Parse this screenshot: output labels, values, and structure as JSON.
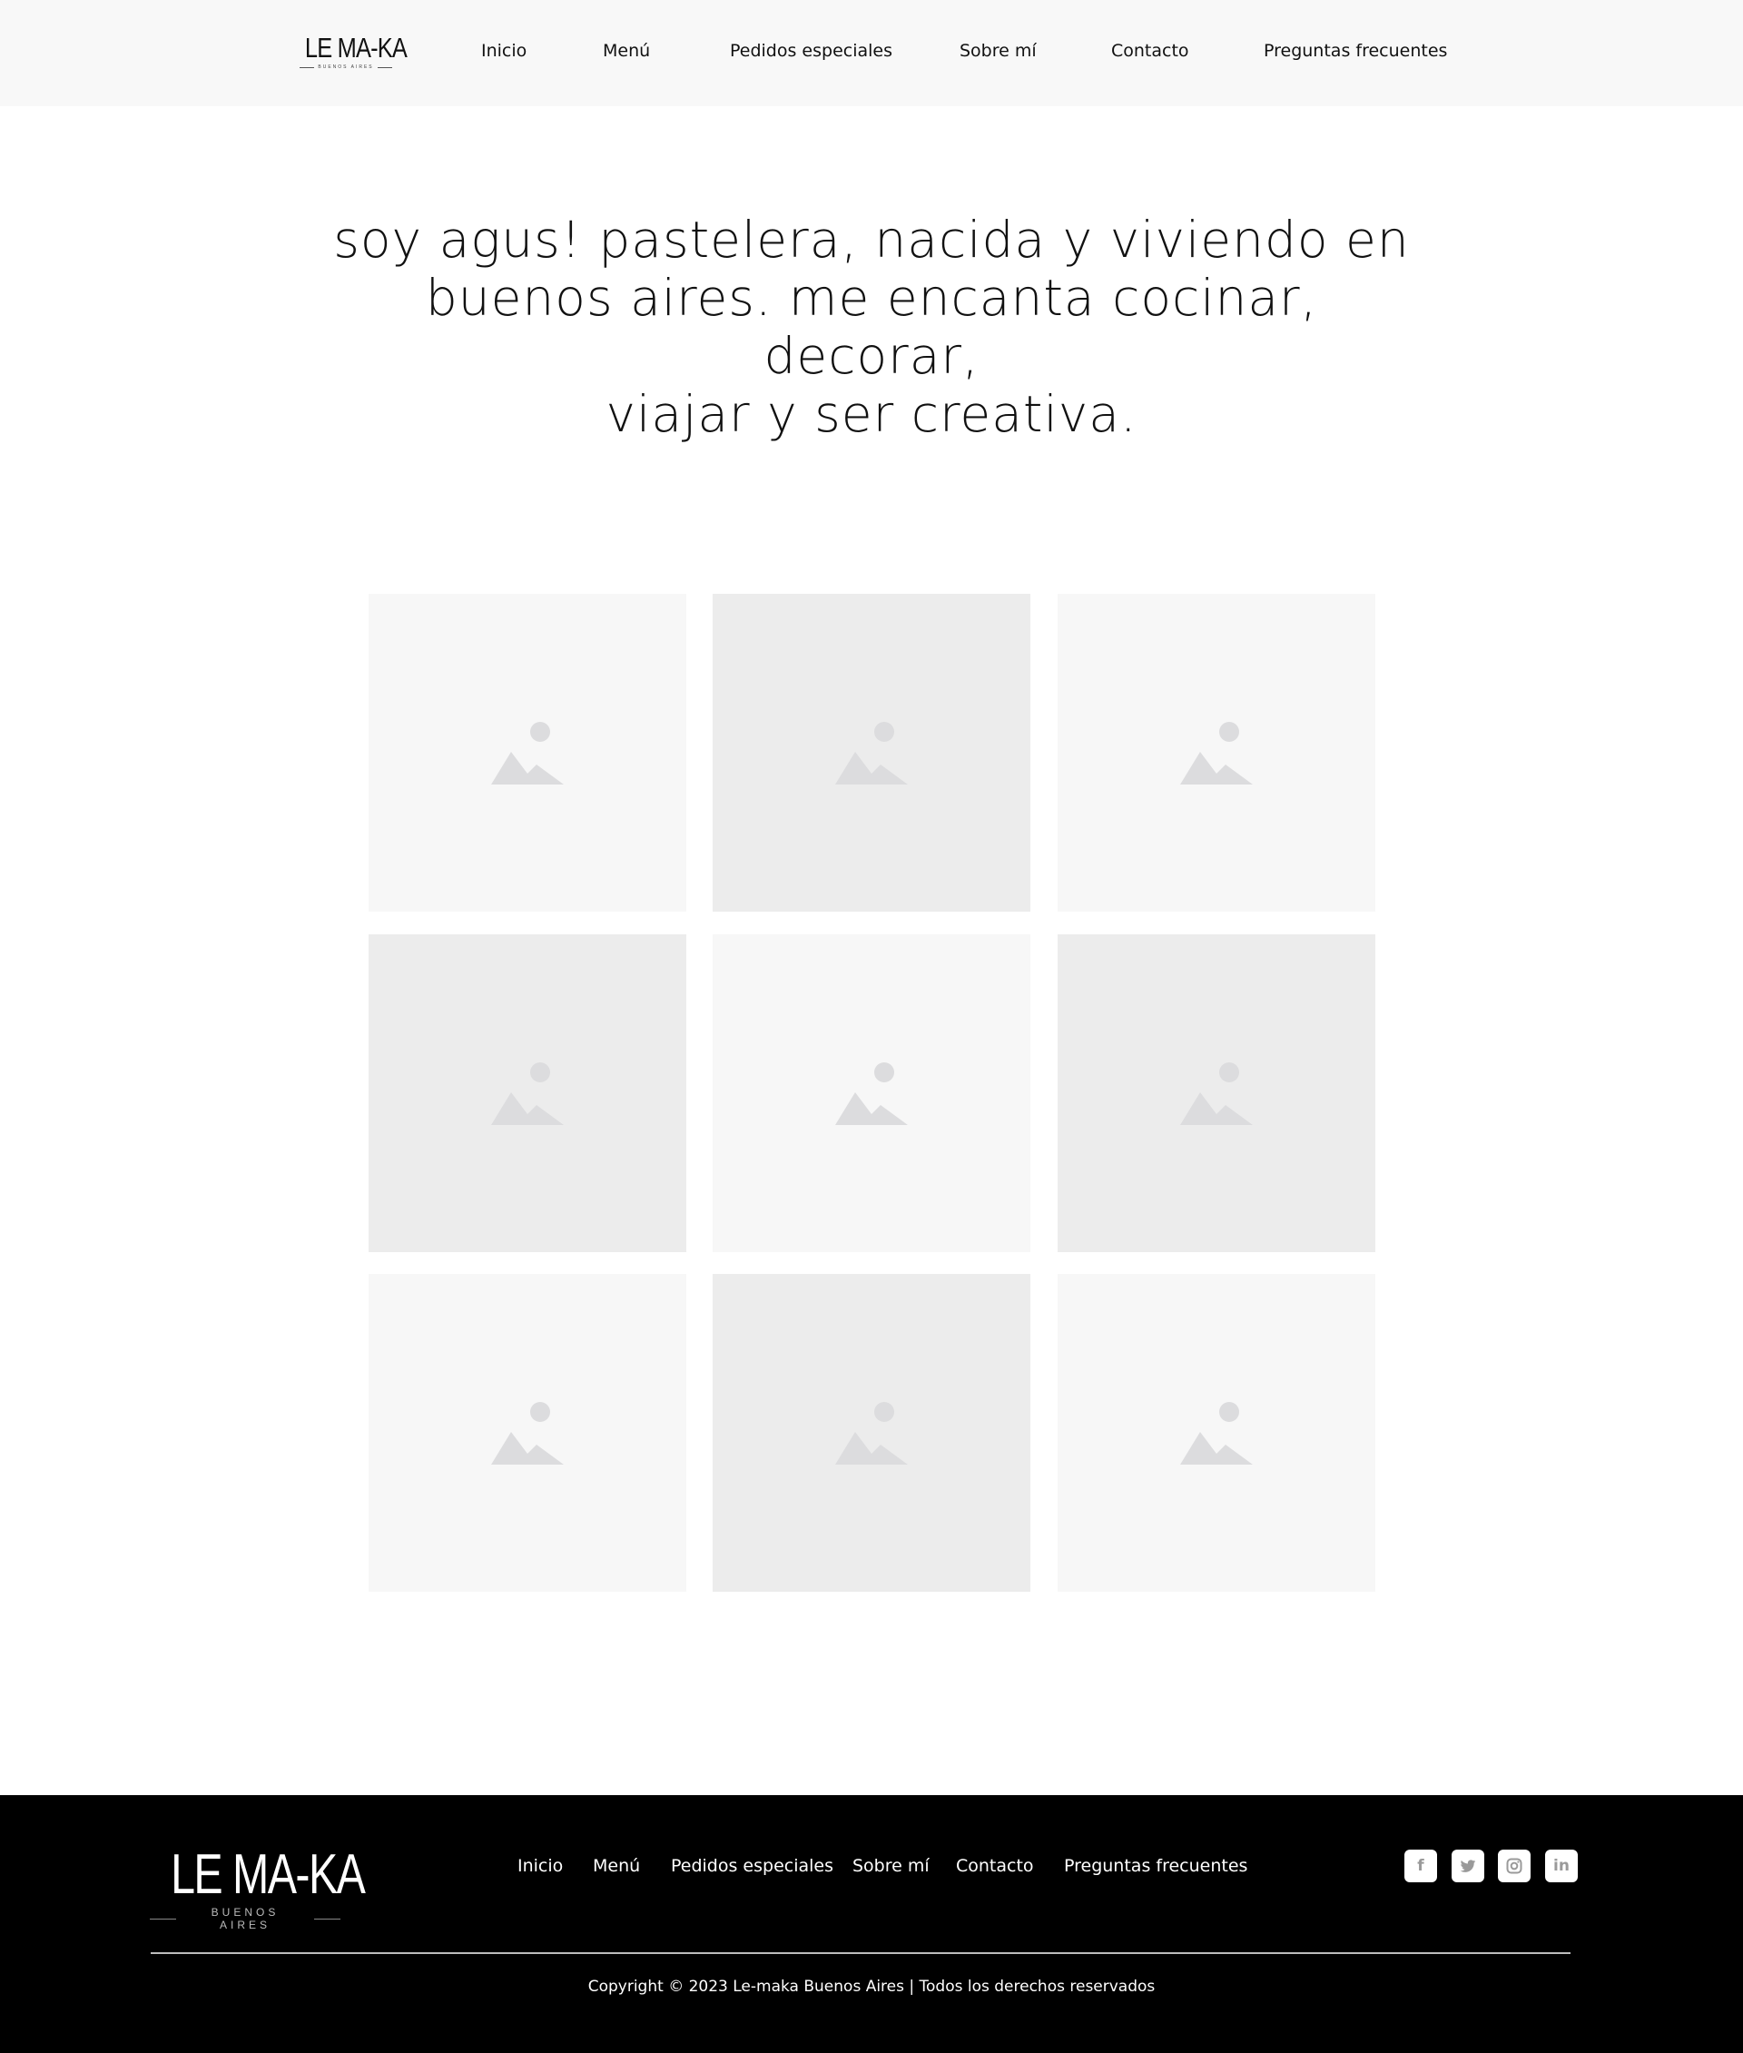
{
  "header": {
    "logo": {
      "main": "LE MA-KA",
      "sub": "BUENOS AIRES"
    },
    "nav": [
      "Inicio",
      "Menú",
      "Pedidos especiales",
      "Sobre mí",
      "Contacto",
      "Preguntas frecuentes"
    ]
  },
  "hero": {
    "line1": "soy agus! pastelera, nacida y viviendo en",
    "line2": "buenos aires. me encanta cocinar, decorar,",
    "line3": "viajar y ser creativa."
  },
  "gallery": {
    "tiles": [
      "image-placeholder",
      "image-placeholder",
      "image-placeholder",
      "image-placeholder",
      "image-placeholder",
      "image-placeholder",
      "image-placeholder",
      "image-placeholder",
      "image-placeholder"
    ]
  },
  "footer": {
    "logo": {
      "main": "LE MA-KA",
      "sub": "BUENOS AIRES"
    },
    "nav": [
      "Inicio",
      "Menú",
      "Pedidos especiales",
      "Sobre mí",
      "Contacto",
      "Preguntas frecuentes"
    ],
    "social": {
      "facebook": "f",
      "twitter": "twitter-icon",
      "instagram": "instagram-icon",
      "linkedin": "in"
    },
    "copyright": "Copyright © 2023 Le-maka Buenos Aires | Todos los derechos reservados"
  },
  "colors": {
    "header_bg": "#f8f8f8",
    "footer_bg": "#000000",
    "tile_light": "#f7f7f7",
    "tile_dark": "#ececec",
    "placeholder_icon": "#dcdcde"
  }
}
